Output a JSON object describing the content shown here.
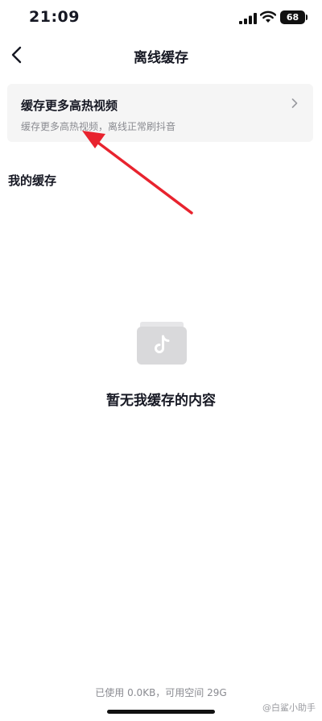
{
  "status_bar": {
    "time": "21:09",
    "battery": "68",
    "icons": [
      "signal-icon",
      "wifi-icon",
      "battery-icon"
    ]
  },
  "nav": {
    "back_icon": "chevron-left-icon",
    "title": "离线缓存"
  },
  "promo_card": {
    "title": "缓存更多高热视频",
    "subtitle": "缓存更多高热视频，离线正常刷抖音",
    "icon": "chevron-right-icon"
  },
  "my_cache": {
    "label": "我的缓存",
    "empty_icon": "folder-tiktok-icon",
    "empty_text": "暂无我缓存的内容"
  },
  "footer": {
    "storage_info": "已使用 0.0KB，可用空间 29G",
    "watermark": "@白鲨小助手"
  },
  "colors": {
    "text_primary": "#161823",
    "text_secondary": "#8a8b91",
    "card_bg": "#f5f5f5",
    "annotation_arrow": "#e8232e",
    "empty_icon": "#d9d9db"
  }
}
